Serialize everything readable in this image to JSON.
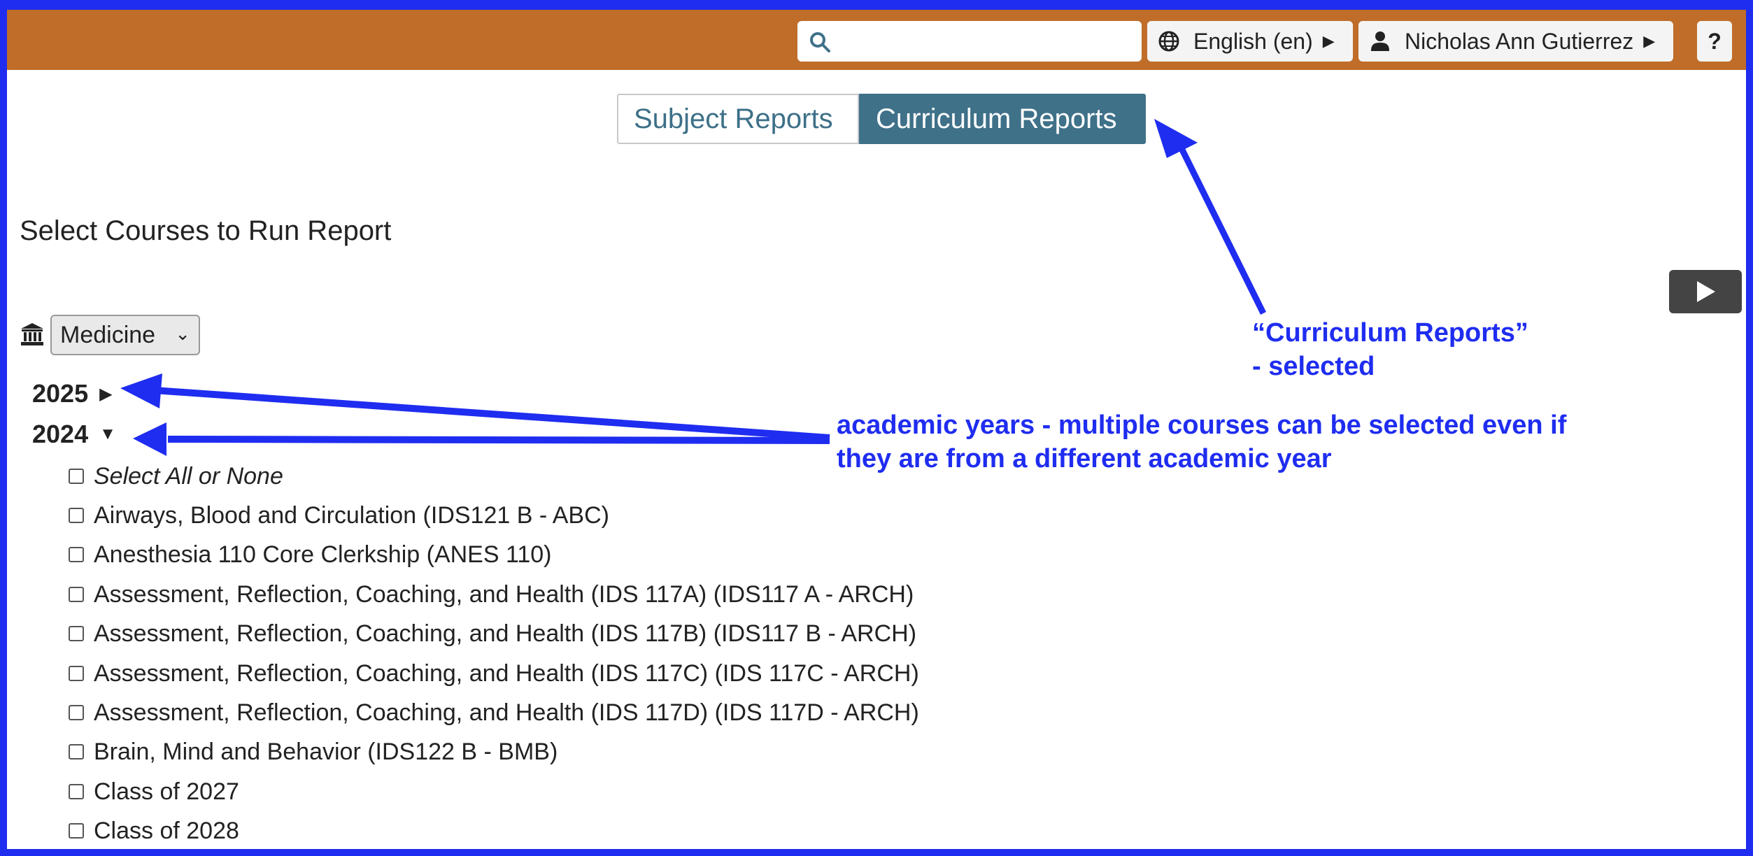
{
  "header": {
    "search_placeholder": "",
    "language_label": "English (en)",
    "user_name": "Nicholas Ann Gutierrez",
    "help_label": "?",
    "color": "#c06d2a"
  },
  "tabs": {
    "subject": "Subject Reports",
    "curriculum": "Curriculum Reports",
    "selected": "Curriculum Reports"
  },
  "page": {
    "heading": "Select Courses to Run Report"
  },
  "school": {
    "selected": "Medicine"
  },
  "years": [
    {
      "label": "2025",
      "expanded": false
    },
    {
      "label": "2024",
      "expanded": true
    }
  ],
  "courses": [
    "Select All or None",
    "Airways, Blood and Circulation (IDS121 B - ABC)",
    "Anesthesia 110 Core Clerkship (ANES 110)",
    "Assessment, Reflection, Coaching, and Health (IDS 117A) (IDS117 A - ARCH)",
    "Assessment, Reflection, Coaching, and Health (IDS 117B) (IDS117 B - ARCH)",
    "Assessment, Reflection, Coaching, and Health (IDS 117C) (IDS 117C - ARCH)",
    "Assessment, Reflection, Coaching, and Health (IDS 117D) (IDS 117D - ARCH)",
    "Brain, Mind and Behavior (IDS122 B - BMB)",
    "Class of 2027",
    "Class of 2028"
  ],
  "annotations": {
    "curriculum_line1": "“Curriculum Reports”",
    "curriculum_line2": "- selected",
    "years_line1": "academic years - multiple courses can be selected even if",
    "years_line2": "they are from a different academic year",
    "color": "#1f2df0"
  }
}
